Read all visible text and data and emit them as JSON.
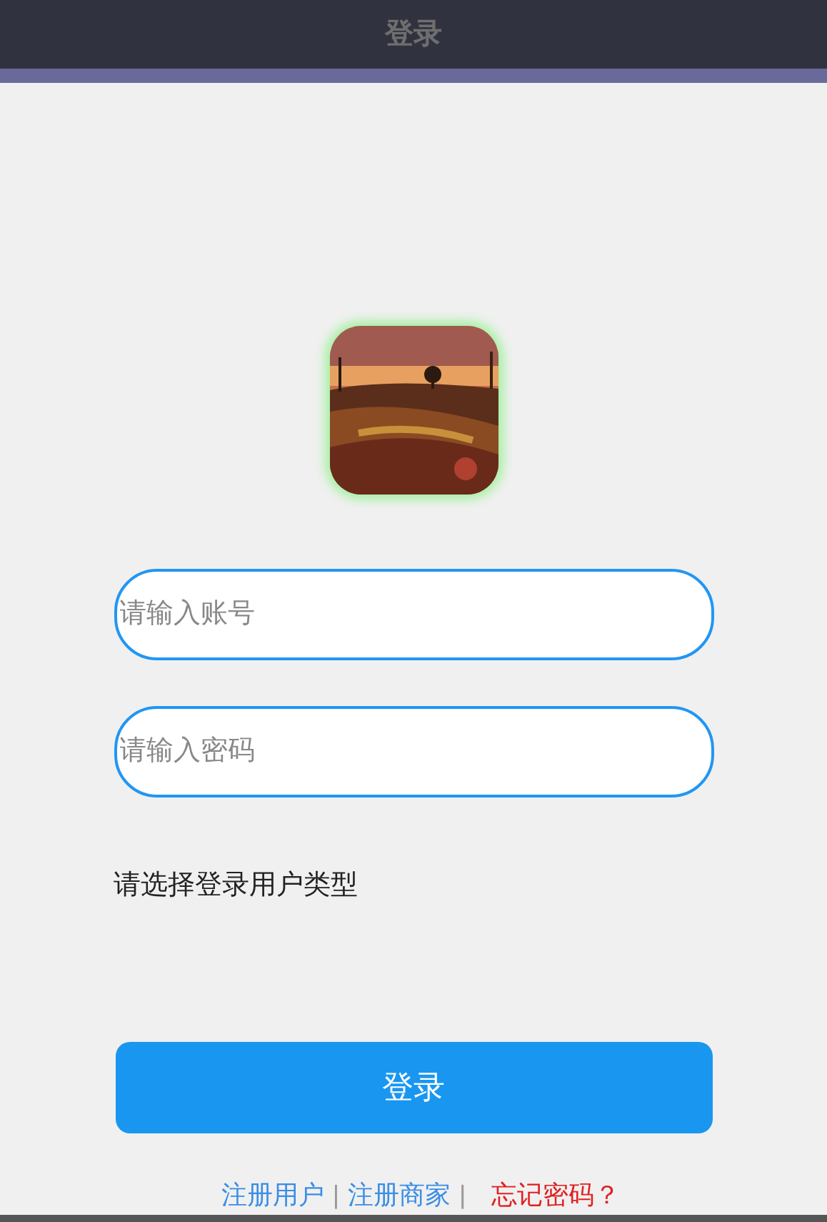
{
  "header": {
    "title": "登录"
  },
  "fields": [
    {
      "placeholder": "请输入账号"
    },
    {
      "placeholder": "请输入密码"
    }
  ],
  "user_type_label": "请选择登录用户类型",
  "login_button": "登录",
  "links": [
    {
      "kind": "link",
      "text": "注册用户"
    },
    {
      "kind": "separator",
      "text": "|"
    },
    {
      "kind": "link",
      "text": "注册商家"
    },
    {
      "kind": "separator",
      "text": "|"
    },
    {
      "kind": "warning",
      "text": "忘记密码？"
    }
  ]
}
